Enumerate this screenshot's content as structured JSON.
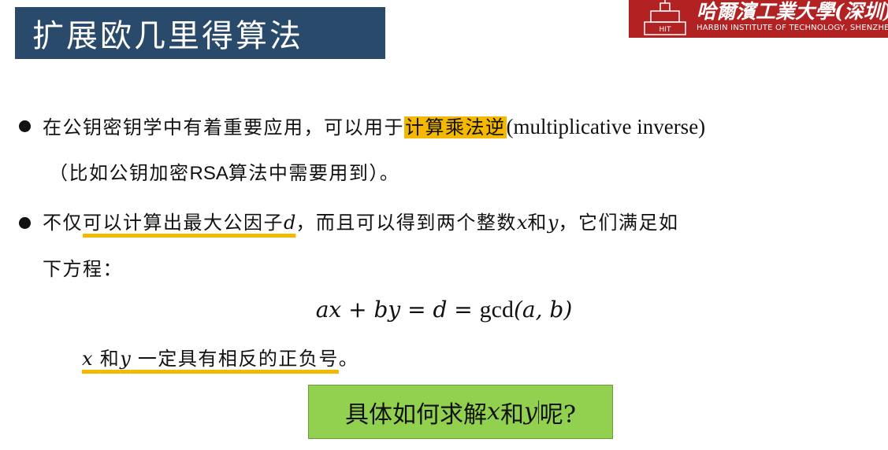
{
  "title": "扩展欧几里得算法",
  "logo": {
    "cn": "哈爾濱工業大學(深圳)",
    "en": "HARBIN INSTITUTE OF TECHNOLOGY, SHENZHEN",
    "emblem_text": "HIT",
    "bg_color": "#b22222"
  },
  "bullet1": {
    "part1": "在公钥密钥学中有着重要应用，可以用于",
    "highlight": "计算乘法逆",
    "part2": "(multiplicative inverse)",
    "line2_a": "（比如公钥加密",
    "line2_rsa": "RSA",
    "line2_b": "算法中需要用到）。"
  },
  "bullet2": {
    "part1": "不仅",
    "underlined": "可以计算出最大公因子",
    "var_d": "d",
    "part2": "，而且可以得到两个整数",
    "var_x": "x",
    "and": "和",
    "var_y": "y",
    "part3": "，它们满足如",
    "line2": "下方程："
  },
  "equation": {
    "lhs": "ax + by = d = ",
    "gcd": "gcd",
    "args": "(a, b)"
  },
  "sign_note": {
    "var_x": "x",
    "and": "和",
    "var_y": "y",
    "text": "一定具有相反的正负号",
    "end": "。"
  },
  "question_box": {
    "a": "具体如何求解",
    "x": "x",
    "and": "和",
    "y": "y",
    "b": "呢?",
    "bg_color": "#92d050"
  },
  "colors": {
    "title_bg": "#2a4a6b",
    "highlight": "#f5b800"
  }
}
